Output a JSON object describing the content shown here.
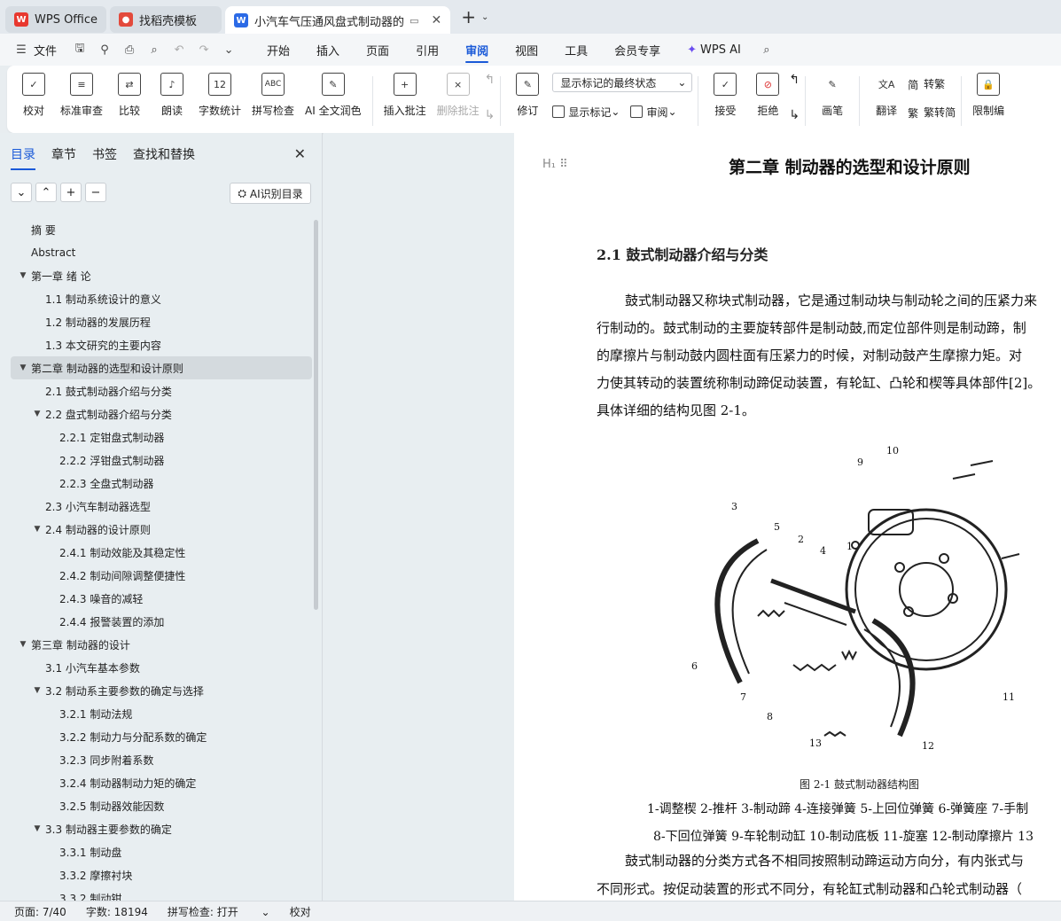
{
  "titlebar": {
    "tabs": [
      {
        "label": "WPS Office",
        "icon": "wps-logo"
      },
      {
        "label": "找稻壳模板",
        "icon": "docer-logo"
      },
      {
        "label": "小汽车气压通风盘式制动器的",
        "icon": "writer-logo"
      }
    ],
    "colors": {
      "wps": "#e8382f",
      "docer": "#e34a3c",
      "writer": "#2b6ae6"
    }
  },
  "menubar": {
    "file_label": "文件",
    "items": [
      "开始",
      "插入",
      "页面",
      "引用",
      "审阅",
      "视图",
      "工具",
      "会员专享"
    ],
    "active": "审阅",
    "ai_label": "WPS AI"
  },
  "ribbon": {
    "proof": "校对",
    "standard_review": "标准审查",
    "compare": "比较",
    "read_aloud": "朗读",
    "word_count": "字数统计",
    "spell_check": "拼写检查",
    "ai_polish": "AI 全文润色",
    "insert_comment": "插入批注",
    "delete_comment": "删除批注",
    "track_changes": "修订",
    "display_select": "显示标记的最终状态",
    "show_markup": "显示标记",
    "review_pane": "审阅",
    "accept": "接受",
    "reject": "拒绝",
    "pen": "画笔",
    "translate": "翻译",
    "to_traditional": "转繁",
    "to_simplified": "繁转简",
    "restrict_edit": "限制编"
  },
  "sidebar": {
    "tabs": [
      "目录",
      "章节",
      "书签",
      "查找和替换"
    ],
    "active_tab": "目录",
    "ai_outline": "AI识别目录",
    "toc": [
      {
        "label": "摘  要",
        "level": 1,
        "toggle": ""
      },
      {
        "label": "Abstract",
        "level": 1,
        "toggle": ""
      },
      {
        "label": "第一章 绪  论",
        "level": 1,
        "toggle": "▼"
      },
      {
        "label": "1.1 制动系统设计的意义",
        "level": 2,
        "toggle": ""
      },
      {
        "label": "1.2 制动器的发展历程",
        "level": 2,
        "toggle": ""
      },
      {
        "label": "1.3 本文研究的主要内容",
        "level": 2,
        "toggle": ""
      },
      {
        "label": "第二章  制动器的选型和设计原则",
        "level": 1,
        "toggle": "▼",
        "active": true
      },
      {
        "label": "2.1 鼓式制动器介绍与分类",
        "level": 2,
        "toggle": ""
      },
      {
        "label": "2.2 盘式制动器介绍与分类",
        "level": 2,
        "toggle": "▼"
      },
      {
        "label": "2.2.1 定钳盘式制动器",
        "level": 3,
        "toggle": ""
      },
      {
        "label": "2.2.2 浮钳盘式制动器",
        "level": 3,
        "toggle": ""
      },
      {
        "label": "2.2.3 全盘式制动器",
        "level": 3,
        "toggle": ""
      },
      {
        "label": "2.3 小汽车制动器选型",
        "level": 2,
        "toggle": ""
      },
      {
        "label": "2.4 制动器的设计原则",
        "level": 2,
        "toggle": "▼"
      },
      {
        "label": "2.4.1 制动效能及其稳定性",
        "level": 3,
        "toggle": ""
      },
      {
        "label": "2.4.2 制动间隙调整便捷性",
        "level": 3,
        "toggle": ""
      },
      {
        "label": "2.4.3 噪音的减轻",
        "level": 3,
        "toggle": ""
      },
      {
        "label": "2.4.4 报警装置的添加",
        "level": 3,
        "toggle": ""
      },
      {
        "label": "第三章 制动器的设计",
        "level": 1,
        "toggle": "▼"
      },
      {
        "label": "3.1 小汽车基本参数",
        "level": 2,
        "toggle": ""
      },
      {
        "label": "3.2 制动系主要参数的确定与选择",
        "level": 2,
        "toggle": "▼"
      },
      {
        "label": "3.2.1 制动法规",
        "level": 3,
        "toggle": ""
      },
      {
        "label": "3.2.2 制动力与分配系数的确定",
        "level": 3,
        "toggle": ""
      },
      {
        "label": "3.2.3 同步附着系数",
        "level": 3,
        "toggle": ""
      },
      {
        "label": "3.2.4 制动器制动力矩的确定",
        "level": 3,
        "toggle": ""
      },
      {
        "label": "3.2.5 制动器效能因数",
        "level": 3,
        "toggle": ""
      },
      {
        "label": "3.3 制动器主要参数的确定",
        "level": 2,
        "toggle": "▼"
      },
      {
        "label": "3.3.1 制动盘",
        "level": 3,
        "toggle": ""
      },
      {
        "label": "3.3.2 摩擦衬块",
        "level": 3,
        "toggle": ""
      },
      {
        "label": "3.3.2 制动钳",
        "level": 3,
        "toggle": ""
      }
    ]
  },
  "document": {
    "heading_marker": "H₁ ⠿",
    "chapter_title": "第二章  制动器的选型和设计原则",
    "section_title": "2.1 鼓式制动器介绍与分类",
    "paragraph1": [
      "鼓式制动器又称块式制动器，它是通过制动块与制动轮之间的压紧力来",
      "行制动的。鼓式制动的主要旋转部件是制动鼓,而定位部件则是制动蹄，制",
      "的摩擦片与制动鼓内圆柱面有压紧力的时候，对制动鼓产生摩擦力矩。对",
      "力使其转动的装置统称制动蹄促动装置，有轮缸、凸轮和楔等具体部件[2]。",
      "具体详细的结构见图 2-1。"
    ],
    "figure_caption": "图 2-1 鼓式制动器结构图",
    "figure_numbers": [
      "1",
      "2",
      "3",
      "4",
      "5",
      "6",
      "7",
      "8",
      "9",
      "10",
      "11",
      "12",
      "13"
    ],
    "legend1": "1-调整楔 2-推杆 3-制动蹄 4-连接弹簧 5-上回位弹簧 6-弹簧座 7-手制",
    "legend2": "8-下回位弹簧 9-车轮制动缸 10-制动底板 11-旋塞 12-制动摩擦片 13",
    "paragraph2": [
      "鼓式制动器的分类方式各不相同按照制动蹄运动方向分，有内张式与",
      "不同形式。按促动装置的形式不同分，有轮缸式制动器和凸轮式制动器（"
    ]
  },
  "statusbar": {
    "page": "页面: 7/40",
    "words": "字数: 18194",
    "spell": "拼写检查: 打开",
    "proof": "校对"
  }
}
